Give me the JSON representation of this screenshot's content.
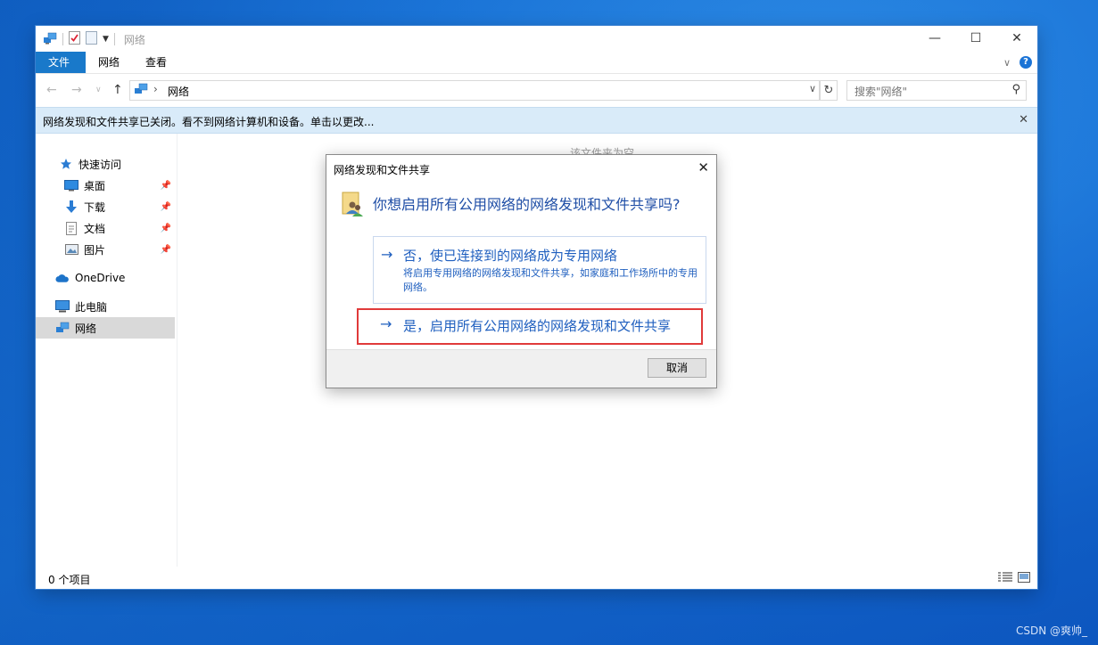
{
  "window": {
    "title": "网络",
    "minimize": "—",
    "maximize": "☐",
    "close": "✕"
  },
  "ribbon": {
    "tabs": [
      "文件",
      "网络",
      "查看"
    ],
    "expand": "∨",
    "help": "?"
  },
  "address": {
    "crumb_sep": "›",
    "path": "网络",
    "search_placeholder": "搜索\"网络\""
  },
  "infobar": {
    "message": "网络发现和文件共享已关闭。看不到网络计算机和设备。单击以更改...",
    "close": "✕"
  },
  "nav": {
    "items": [
      {
        "label": "快速访问",
        "icon": "star-icon"
      },
      {
        "label": "桌面",
        "icon": "desktop-icon"
      },
      {
        "label": "下载",
        "icon": "download-icon"
      },
      {
        "label": "文档",
        "icon": "document-icon"
      },
      {
        "label": "图片",
        "icon": "pictures-icon"
      },
      {
        "label": "OneDrive",
        "icon": "cloud-icon"
      },
      {
        "label": "此电脑",
        "icon": "computer-icon"
      },
      {
        "label": "网络",
        "icon": "network-icon"
      }
    ]
  },
  "content": {
    "empty_text": "该文件夹为空。"
  },
  "status": {
    "count": "0 个项目"
  },
  "dialog": {
    "title": "网络发现和文件共享",
    "close": "✕",
    "question": "你想启用所有公用网络的网络发现和文件共享吗?",
    "option_no": {
      "arrow": "→",
      "label": "否，使已连接到的网络成为专用网络",
      "desc": "将启用专用网络的网络发现和文件共享，如家庭和工作场所中的专用网络。"
    },
    "option_yes": {
      "arrow": "→",
      "label": "是，启用所有公用网络的网络发现和文件共享"
    },
    "cancel": "取消"
  },
  "watermark": "CSDN @爽帅_",
  "colors": {
    "accent": "#1979ca",
    "link": "#1f5fbf",
    "highlight_border": "#e03a3a",
    "infobar_bg": "#d9ebf9"
  }
}
